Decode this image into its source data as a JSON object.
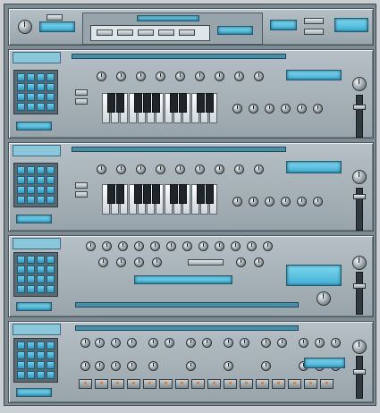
{
  "app": {
    "title": "",
    "accent_color": "#4fc1e4",
    "panel_color": "#a9b4ba",
    "rack_color": "#7e8b93"
  },
  "header": {
    "transport_buttons": [
      "",
      "",
      "",
      "",
      ""
    ],
    "display_left": "",
    "display_center": "",
    "display_right": ""
  },
  "modules": [
    {
      "id": "module-1",
      "type": "synth",
      "logo": "",
      "display_main": "",
      "display_side": ""
    },
    {
      "id": "module-2",
      "type": "synth",
      "logo": "",
      "display_main": "",
      "display_side": ""
    },
    {
      "id": "module-3",
      "type": "synth",
      "logo": "",
      "display_main": "",
      "display_side": ""
    },
    {
      "id": "module-4",
      "type": "drum-sequencer",
      "logo": "",
      "display_main": "",
      "display_side": ""
    }
  ],
  "icons": {
    "pad": "pad-button",
    "knob": "rotary-knob",
    "fader": "volume-fader",
    "key": "piano-key"
  }
}
